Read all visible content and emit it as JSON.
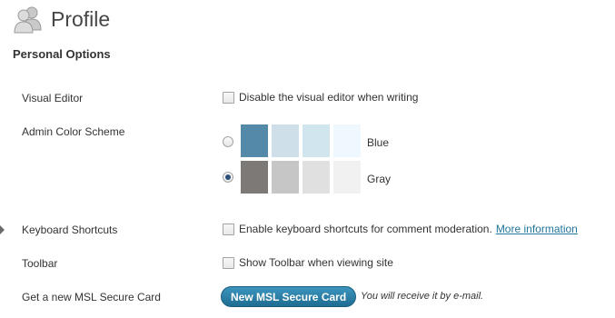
{
  "header": {
    "title": "Profile",
    "icon": "users-icon"
  },
  "personal_options": {
    "heading": "Personal Options",
    "visual_editor": {
      "label": "Visual Editor",
      "checkbox_text": "Disable the visual editor when writing",
      "checked": false
    },
    "admin_color_scheme": {
      "label": "Admin Color Scheme",
      "schemes": [
        {
          "name": "Blue",
          "selected": false,
          "colors": [
            "#5589aa",
            "#cfdfe9",
            "#d1e5ee",
            "#eff8ff"
          ]
        },
        {
          "name": "Gray",
          "selected": true,
          "colors": [
            "#7c7976",
            "#c6c6c6",
            "#e0e0e0",
            "#f1f1f1"
          ]
        }
      ]
    },
    "keyboard_shortcuts": {
      "label": "Keyboard Shortcuts",
      "checkbox_text": "Enable keyboard shortcuts for comment moderation.",
      "link_text": "More information",
      "checked": false
    },
    "toolbar": {
      "label": "Toolbar",
      "checkbox_text": "Show Toolbar when viewing site",
      "checked": false
    },
    "msl_card": {
      "label": "Get a new MSL Secure Card",
      "button_label": "New MSL Secure Card",
      "note": "You will receive it by e-mail."
    }
  },
  "colors": {
    "link": "#21759b",
    "button": "#2a82ab"
  }
}
